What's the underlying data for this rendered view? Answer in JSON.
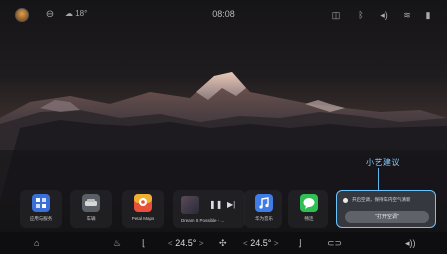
{
  "status_bar": {
    "weather": "18°",
    "time": "08:08",
    "icons": [
      "avatar",
      "account-icon",
      "weather-icon",
      "camera-icon",
      "bluetooth-icon",
      "wifi-icon",
      "signal-icon"
    ]
  },
  "dock": {
    "apps": [
      {
        "label": "应用与服务",
        "icon": "apps-grid-icon",
        "color": "#3a6fd8"
      },
      {
        "label": "车辆",
        "icon": "car-icon",
        "color": "#5a5f66"
      },
      {
        "label": "Petal Maps",
        "icon": "map-icon",
        "color": "#e8503a"
      },
      {
        "label": "华为音乐",
        "icon": "music-icon",
        "color": "#3f7ce8"
      },
      {
        "label": "畅连",
        "icon": "chat-icon",
        "color": "#2fbf55"
      }
    ],
    "media": {
      "title": "Dream It Possible - ...",
      "play_state": "paused"
    }
  },
  "suggestion": {
    "label": "小艺建议",
    "text": "开启空调，保持车内空气清新",
    "action": "\"打开空调\""
  },
  "bottom_bar": {
    "left_temp": "24.5°",
    "right_temp": "24.5°",
    "icons": [
      "home-icon",
      "seat-heat-icon",
      "seat-icon",
      "fan-icon",
      "seat-right-icon",
      "car-front-icon",
      "volume-icon"
    ]
  }
}
